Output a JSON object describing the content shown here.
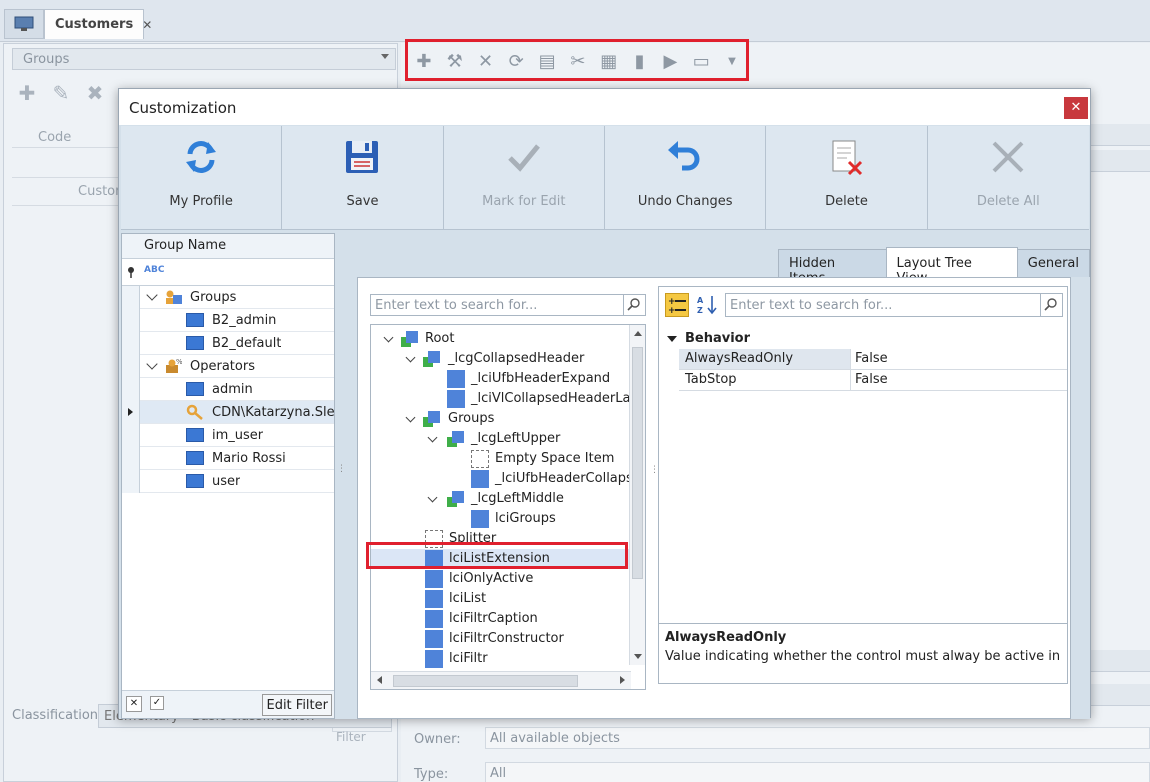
{
  "app": {
    "doc_tab": "Customers",
    "left_panel": {
      "groups_combo": "Groups",
      "code_header": "Code",
      "row_label": "Custom",
      "edit_filter": "Edit Filter",
      "classification_label": "Classification:",
      "classification_value": "Elementary - Basic classification"
    },
    "main": {
      "owner_label": "Owner:",
      "owner_value": "All available objects",
      "type_label": "Type:",
      "type_value": "All"
    }
  },
  "dialog": {
    "title": "Customization",
    "ribbon": [
      {
        "label": "My Profile",
        "icon": "refresh-icon"
      },
      {
        "label": "Save",
        "icon": "floppy-icon"
      },
      {
        "label": "Mark for Edit",
        "icon": "checkmark-icon"
      },
      {
        "label": "Undo Changes",
        "icon": "undo-icon"
      },
      {
        "label": "Delete",
        "icon": "delete-doc-icon"
      },
      {
        "label": "Delete All",
        "icon": "big-x-icon"
      }
    ],
    "group_grid": {
      "header": "Group Name",
      "rows": [
        {
          "label": "Groups",
          "type": "folder"
        },
        {
          "label": "B2_admin",
          "type": "item"
        },
        {
          "label": "B2_default",
          "type": "item"
        },
        {
          "label": "Operators",
          "type": "folder"
        },
        {
          "label": "admin",
          "type": "item"
        },
        {
          "label": "CDN\\Katarzyna.Sle...",
          "type": "key"
        },
        {
          "label": "im_user",
          "type": "item"
        },
        {
          "label": "Mario Rossi",
          "type": "item"
        },
        {
          "label": "user",
          "type": "item"
        }
      ],
      "edit_filter": "Edit Filter"
    },
    "tabs": [
      "Hidden Items",
      "Layout Tree View",
      "General"
    ],
    "tree": {
      "search_placeholder": "Enter text to search for...",
      "items": [
        {
          "label": "Root",
          "icon": "group"
        },
        {
          "label": "_lcgCollapsedHeader",
          "icon": "group"
        },
        {
          "label": "_lciUfbHeaderExpand",
          "icon": "item"
        },
        {
          "label": "_lciVlCollapsedHeaderLabel",
          "icon": "item"
        },
        {
          "label": "Groups",
          "icon": "group"
        },
        {
          "label": "_lcgLeftUpper",
          "icon": "group"
        },
        {
          "label": "Empty Space Item",
          "icon": "empty"
        },
        {
          "label": "_lciUfbHeaderCollapse",
          "icon": "item"
        },
        {
          "label": "_lcgLeftMiddle",
          "icon": "group"
        },
        {
          "label": "lciGroups",
          "icon": "item"
        },
        {
          "label": "Splitter",
          "icon": "splitter"
        },
        {
          "label": "lciListExtension",
          "icon": "item"
        },
        {
          "label": "lciOnlyActive",
          "icon": "item"
        },
        {
          "label": "lciList",
          "icon": "item"
        },
        {
          "label": "lciFiltrCaption",
          "icon": "item"
        },
        {
          "label": "lciFiltrConstructor",
          "icon": "item"
        },
        {
          "label": "lciFiltr",
          "icon": "item"
        }
      ]
    },
    "props": {
      "search_placeholder": "Enter text to search for...",
      "category": "Behavior",
      "rows": [
        {
          "name": "AlwaysReadOnly",
          "value": "False"
        },
        {
          "name": "TabStop",
          "value": "False"
        }
      ],
      "desc_title": "AlwaysReadOnly",
      "desc_text": "Value indicating whether the control must alway be active in th..."
    }
  }
}
